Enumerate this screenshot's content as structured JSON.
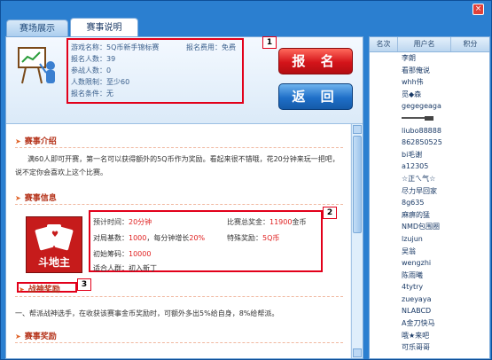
{
  "window": {
    "close_label": "×"
  },
  "tabs": [
    {
      "label": "赛场展示"
    },
    {
      "label": "赛事说明"
    }
  ],
  "match_info": {
    "rows": [
      "游戏名称：5Q币新手锦标赛",
      "报名人数：39",
      "参战人数：0",
      "人数限制：至少60",
      "报名条件：无"
    ],
    "fee": "报名费用：免费",
    "badge": "1"
  },
  "buttons": {
    "signup": "报 名",
    "back": "返 回"
  },
  "sections": {
    "intro_title": "赛事介绍",
    "intro_text": "满60人即可开赛，第一名可以获得额外的5Q币作为奖励。看起来很不错哦，花20分钟来玩一把吧，说不定你会喜欢上这个比赛。",
    "info_title": "赛事信息",
    "battle_title": "战神奖励",
    "battle_text": "一、帮派战神选手，在收获该赛事金币奖励时，可额外多出5%给自身，8%给帮派。",
    "reward_title": "赛事奖励"
  },
  "game": {
    "logo_text": "斗地主"
  },
  "match_details": {
    "badge": "2",
    "est_time_label": "预计时间：",
    "est_time_value": "20分钟",
    "rounds_label": "对局基数：",
    "rounds_value": "1000",
    "rounds_suffix": "，每分钟增长",
    "growth_value": "20%",
    "init_chips_label": "初始筹码：",
    "init_chips_value": "10000",
    "audience": "适合人群：初入新丁",
    "prize_label": "比赛总奖金：",
    "prize_value": "11900",
    "prize_unit": "金币",
    "special_label": "特殊奖励：",
    "special_value": "5Q币"
  },
  "battle_badge": "3",
  "ranking": {
    "headers": [
      "名次",
      "用户名",
      "积分"
    ],
    "users": [
      "李朗",
      "看那俺说",
      "whh伟",
      "觅◆森",
      "gegegeaga",
      "",
      "liubo88888",
      "862850525",
      "bi毛谢",
      "a12305",
      "☆正ㄟ气☆",
      "尽力早回家",
      "8g635",
      "麻痹的猛",
      "NMD包围圈",
      "lzujun",
      "吴翁",
      "wengzhi",
      "陈雨曦",
      "4tytry",
      "zueyaya",
      "NLABCD",
      "A金刀快马",
      "哦★来吧",
      "可乐哥哥"
    ]
  }
}
